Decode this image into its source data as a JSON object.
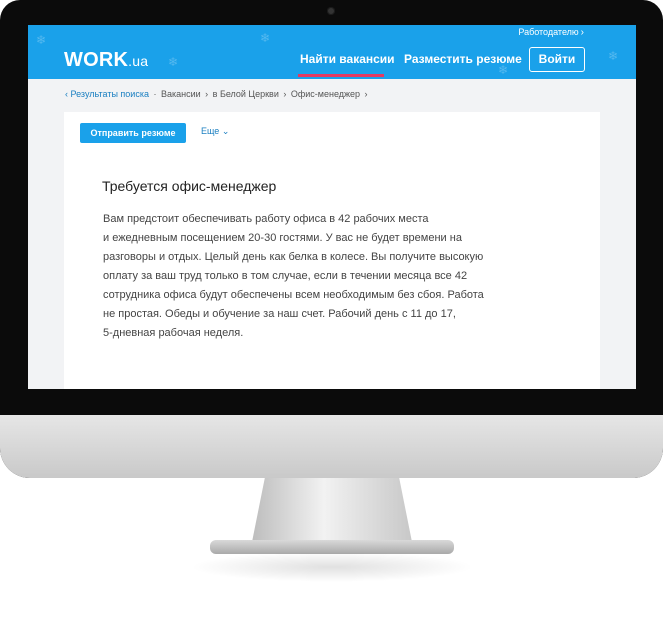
{
  "header": {
    "employer_link": "Работодателю",
    "logo_main": "WORK",
    "logo_suffix": ".ua",
    "nav_find": "Найти вакансии",
    "nav_post": "Разместить резюме",
    "login": "Войти",
    "brand_color": "#1aa1ea",
    "accent_color": "#e43a62"
  },
  "breadcrumb": {
    "items": [
      "Результаты поиска",
      "Вакансии",
      "в Белой Церкви",
      "Офис-менеджер"
    ]
  },
  "actions": {
    "send_resume": "Отправить резюме",
    "more": "Еще"
  },
  "vacancy": {
    "title": "Требуется офис-менеджер",
    "description_lines": [
      "Вам предстоит обеспечивать работу офиса в 42 рабочих места",
      "и ежедневным посещением 20-30 гостями. У вас не будет времени на",
      "разговоры и отдых. Целый день как белка в колесе. Вы получите высокую",
      "оплату за ваш труд только в том случае, если в течении месяца все 42",
      "сотрудника офиса будут обеспечены всем необходимым без сбоя. Работа",
      "не простая. Обеды и обучение за наш счет. Рабочий день с 11 до 17,",
      "5-дневная рабочая неделя."
    ]
  }
}
